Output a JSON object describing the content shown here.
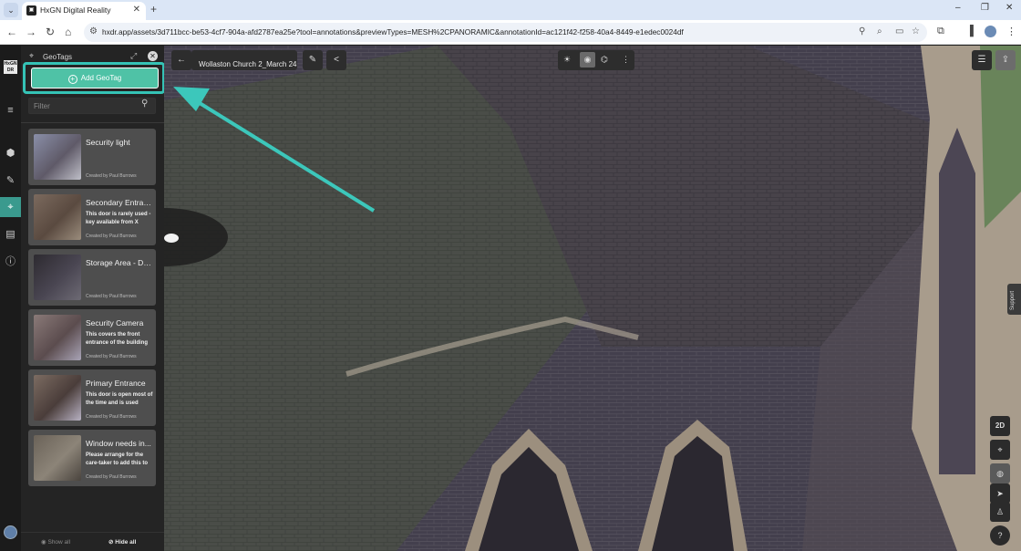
{
  "browser": {
    "tab_menu_icon": "chevron-down-icon",
    "tab_title": "HxGN Digital Reality",
    "tab_close": "✕",
    "new_tab": "+",
    "window_controls": [
      "–",
      "❐",
      "✕"
    ],
    "nav": {
      "back": "←",
      "forward": "→",
      "reload": "↻",
      "home": "⌂"
    },
    "url": "hxdr.app/assets/3d711bcc-be53-4cf7-904a-afd2787ea25e?tool=annotations&previewTypes=MESH%2CPANORAMIC&annotationId=ac121f42-f258-40a4-8449-e1edec0024df"
  },
  "app": {
    "logo": "HxGN DR",
    "rail": [
      {
        "name": "menu-icon",
        "glyph": "≡"
      },
      {
        "name": "layers-icon",
        "glyph": "⬢"
      },
      {
        "name": "measure-icon",
        "glyph": "✎"
      },
      {
        "name": "geotag-icon",
        "glyph": "⌖",
        "active": true
      },
      {
        "name": "notes-icon",
        "glyph": "▤"
      },
      {
        "name": "info-icon",
        "glyph": "ⓘ"
      }
    ]
  },
  "panel": {
    "title": "GeoTags",
    "add_button": "Add GeoTag",
    "filter_placeholder": "Filter",
    "items": [
      {
        "title": "Security light",
        "description": "",
        "author": "Created by Paul Burrows",
        "thumb_colors": [
          "#8a8fa8",
          "#5f5a68",
          "#bfbfc8"
        ]
      },
      {
        "title": "Secondary Entran...",
        "description": "This door is rarely used - key available from X",
        "author": "Created by Paul Burrows",
        "thumb_colors": [
          "#7b6a5e",
          "#5a4a40",
          "#9a8c7c"
        ]
      },
      {
        "title": "Storage Area - DO...",
        "description": "",
        "author": "Created by Paul Burrows",
        "thumb_colors": [
          "#2d2a30",
          "#4a4652",
          "#6d6a74"
        ]
      },
      {
        "title": "Security Camera",
        "description": "This covers the front entrance of the building",
        "author": "Created by Paul Burrows",
        "thumb_colors": [
          "#8a7a78",
          "#5b4c4e",
          "#a9a4b6"
        ]
      },
      {
        "title": "Primary Entrance",
        "description": "This door is open most of the time and is used",
        "author": "Created by Paul Burrows",
        "thumb_colors": [
          "#7c6c62",
          "#4a3d3a",
          "#b7b1c2"
        ]
      },
      {
        "title": "Window needs in...",
        "description": "Please arrange for the care-taker to add this to",
        "author": "Created by Paul Burrows",
        "thumb_colors": [
          "#6a6258",
          "#8c8478",
          "#4a443e"
        ]
      }
    ],
    "footer": {
      "show_all": "Show all",
      "hide_all": "Hide all"
    }
  },
  "viewer": {
    "scene_title": "Wollaston Church 2_March 24",
    "back_icon": "←",
    "measure_icon": "✎",
    "share_icon": "<",
    "mode_icons": [
      "☀",
      "◉",
      "⌬",
      "⋮"
    ],
    "settings_icon": "☰",
    "upload_icon": "⇪",
    "support_label": "Support",
    "right_tools": [
      {
        "name": "2d-toggle-button",
        "glyph": "2D"
      },
      {
        "name": "locate-button",
        "glyph": "⌖"
      },
      {
        "name": "orbit-button",
        "glyph": "◍"
      },
      {
        "name": "navigate-button",
        "glyph": "➤"
      },
      {
        "name": "person-button",
        "glyph": "♙"
      },
      {
        "name": "help-button",
        "glyph": "?"
      }
    ]
  },
  "colors": {
    "accent": "#35c3b6",
    "add_button_bg": "#4fc2a6",
    "panel_bg": "#242424",
    "card_bg": "#4e4e4e",
    "rail_active": "#3a9a8e"
  }
}
